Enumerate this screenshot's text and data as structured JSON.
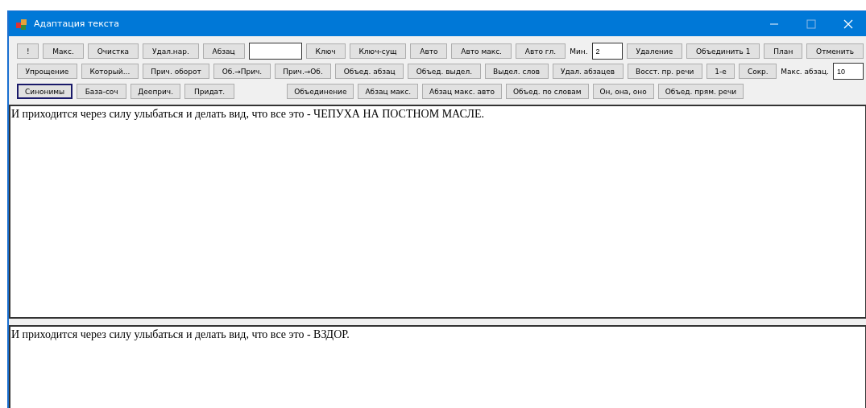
{
  "window": {
    "title": "Адаптация текста"
  },
  "toolbar_rows": [
    [
      {
        "kind": "button",
        "label": "!"
      },
      {
        "kind": "button",
        "label": "Макс."
      },
      {
        "kind": "button",
        "label": "Очистка"
      },
      {
        "kind": "button",
        "label": "Удал.нар."
      },
      {
        "kind": "button",
        "label": "Абзац"
      },
      {
        "kind": "field"
      },
      {
        "kind": "button",
        "label": "Ключ"
      },
      {
        "kind": "button",
        "label": "Ключ-сущ"
      },
      {
        "kind": "button",
        "label": "Авто"
      },
      {
        "kind": "button",
        "label": "Авто макс."
      },
      {
        "kind": "button",
        "label": "Авто гл."
      },
      {
        "kind": "label",
        "label": "Мин."
      },
      {
        "kind": "field",
        "value": "2"
      },
      {
        "kind": "button",
        "label": "Удаление"
      },
      {
        "kind": "button",
        "label": "Объединить 1"
      },
      {
        "kind": "button",
        "label": "План"
      },
      {
        "kind": "button",
        "label": "Отменить"
      }
    ],
    [
      {
        "kind": "button",
        "label": "Упрощение"
      },
      {
        "kind": "button",
        "label": "Который..."
      },
      {
        "kind": "button",
        "label": "Прич. оборот"
      },
      {
        "kind": "button",
        "label": "Об.→Прич."
      },
      {
        "kind": "button",
        "label": "Прич.→Об."
      },
      {
        "kind": "button",
        "label": "Объед. абзац"
      },
      {
        "kind": "button",
        "label": "Объед. выдел."
      },
      {
        "kind": "button",
        "label": "Выдел. слов"
      },
      {
        "kind": "button",
        "label": "Удал. абзацев"
      },
      {
        "kind": "button",
        "label": "Восст. пр. речи"
      },
      {
        "kind": "button",
        "label": "1-е"
      },
      {
        "kind": "button",
        "label": "Сокр."
      },
      {
        "kind": "label",
        "label": "Макс. абзац."
      },
      {
        "kind": "field",
        "value": "10"
      }
    ],
    [
      {
        "kind": "button",
        "label": "Синонимы",
        "focused": true
      },
      {
        "kind": "button",
        "label": "База-соч",
        "focused": false
      },
      {
        "kind": "button",
        "label": "Дееприч.",
        "focused": false
      },
      {
        "kind": "button",
        "label": "Придат.",
        "focused": false
      },
      {
        "kind": "button",
        "label": "Объединение",
        "focused": false
      },
      {
        "kind": "button",
        "label": "Абзац макс.",
        "focused": false
      },
      {
        "kind": "button",
        "label": "Абзац макс. авто",
        "focused": false
      },
      {
        "kind": "button",
        "label": "Объед. по словам",
        "focused": false
      },
      {
        "kind": "button",
        "label": "Он, она, оно",
        "focused": false
      },
      {
        "kind": "button",
        "label": "Объед. прям. речи",
        "focused": false
      }
    ]
  ],
  "source_text": "И приходится через силу улыбаться и делать вид, что все это - ЧЕПУХА НА ПОСТНОМ МАСЛЕ.",
  "result_text": "И приходится через силу улыбаться и делать вид, что все это - ВЗДОР."
}
